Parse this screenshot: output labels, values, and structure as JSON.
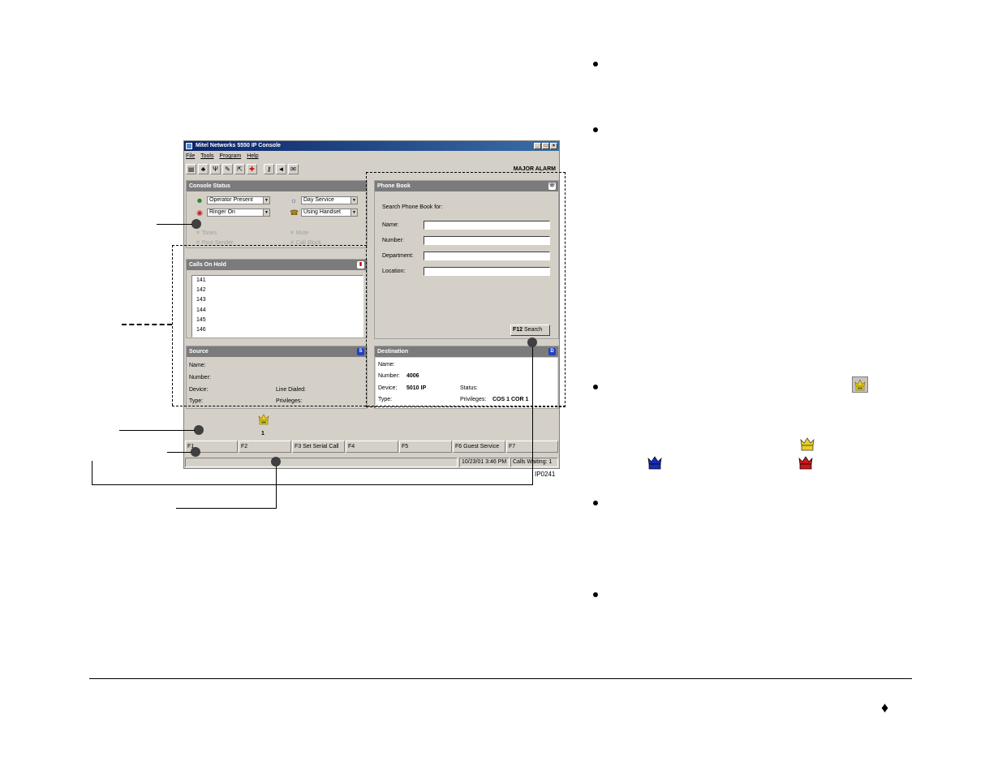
{
  "window": {
    "title": "Mitel Networks 5550 IP Console",
    "menu": [
      "File",
      "Tools",
      "Program",
      "Help"
    ],
    "alarm": "MAJOR ALARM",
    "figure_id": "IP0241"
  },
  "console_status": {
    "header": "Console Status",
    "operator": "Operator Present",
    "service": "Day Service",
    "ringer": "Ringer On",
    "handset": "Using Handset",
    "disabled": [
      "Tones",
      "Mute",
      "Post Sender",
      "Call Block"
    ]
  },
  "calls_on_hold": {
    "header": "Calls On Hold",
    "items": [
      "141",
      "142",
      "143",
      "144",
      "145",
      "146"
    ]
  },
  "phone_book": {
    "header": "Phone Book",
    "prompt": "Search Phone Book for:",
    "labels": [
      "Name:",
      "Number:",
      "Department:",
      "Location:"
    ],
    "search_key": "F12",
    "search_label": "Search"
  },
  "source": {
    "header": "Source",
    "name": "Name:",
    "number": "Number:",
    "device": "Device:",
    "line": "Line Dialed:",
    "type": "Type:",
    "privileges": "Privileges:"
  },
  "destination": {
    "header": "Destination",
    "name_label": "Name:",
    "number_label": "Number:",
    "number_value": "4006",
    "device_label": "Device:",
    "device_value": "5010 IP",
    "status_label": "Status:",
    "type_label": "Type:",
    "privileges_label": "Privileges:",
    "privileges_value": "COS 1 COR 1"
  },
  "waiting_count": "1",
  "fkeys": [
    {
      "key": "F1",
      "label": ""
    },
    {
      "key": "F2",
      "label": ""
    },
    {
      "key": "F3",
      "label": "Set Serial Call"
    },
    {
      "key": "F4",
      "label": ""
    },
    {
      "key": "F5",
      "label": ""
    },
    {
      "key": "F6",
      "label": "Guest Service"
    },
    {
      "key": "F7",
      "label": ""
    }
  ],
  "statusbar": {
    "datetime": "10/23/01 3:46 PM",
    "calls_waiting": "Calls Waiting:  1"
  },
  "colors": {
    "crown_yellow": "#e8d020",
    "crown_blue": "#1a2ab8",
    "crown_red": "#c81818"
  }
}
